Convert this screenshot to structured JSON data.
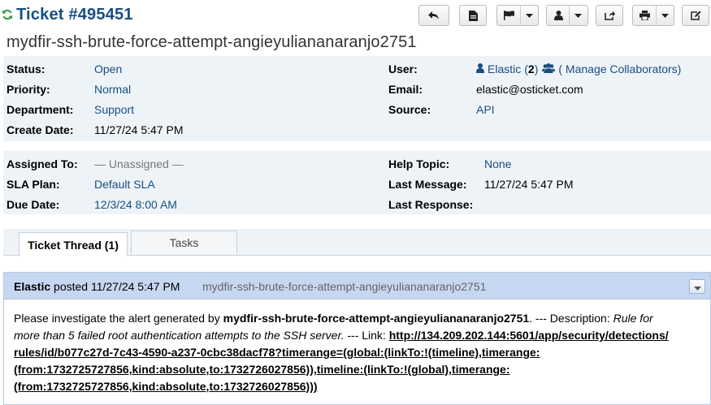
{
  "header": {
    "ticket_number": "Ticket #495451",
    "subject": "mydfir-ssh-brute-force-attempt-angieyuliananaranjo2751"
  },
  "toolbar": {
    "buttons": [
      "reply",
      "edit-document",
      "flag",
      "assign-user",
      "transfer",
      "print",
      "edit"
    ]
  },
  "info1": {
    "status_label": "Status:",
    "status_value": "Open",
    "priority_label": "Priority:",
    "priority_value": "Normal",
    "department_label": "Department:",
    "department_value": "Support",
    "create_date_label": "Create Date:",
    "create_date_value": "11/27/24 5:47 PM",
    "user_label": "User:",
    "user_name": "Elastic",
    "user_count_open": "(",
    "user_count": "2",
    "user_count_close": ")",
    "manage_collaborators": "( Manage Collaborators)",
    "email_label": "Email:",
    "email_value": "elastic@osticket.com",
    "source_label": "Source:",
    "source_value": "API"
  },
  "info2": {
    "assigned_label": "Assigned To:",
    "assigned_value": "— Unassigned —",
    "sla_label": "SLA Plan:",
    "sla_value": "Default SLA",
    "due_label": "Due Date:",
    "due_value": "12/3/24 8:00 AM",
    "help_topic_label": "Help Topic:",
    "help_topic_value": "None",
    "last_message_label": "Last Message:",
    "last_message_value": "11/27/24 5:47 PM",
    "last_response_label": "Last Response:",
    "last_response_value": ""
  },
  "tabs": {
    "thread": "Ticket Thread (1)",
    "tasks": "Tasks"
  },
  "entry": {
    "poster_name": "Elastic",
    "posted_text": "posted 11/27/24 5:47 PM",
    "title": "mydfir-ssh-brute-force-attempt-angieyuliananaranjo2751",
    "body_intro": "Please investigate the alert generated by ",
    "body_alert": "mydfir-ssh-brute-force-attempt-angieyuliananaranjo2751",
    "body_desc_prefix": ". --- Description: ",
    "body_desc_1": "Rule for",
    "body_desc_2": "more than 5 failed root authentication attempts to the SSH server.",
    "body_link_prefix": " --- Link: ",
    "link_line_1": "http://134.209.202.144:5601/app/security/detections/",
    "link_line_2": "rules/id/b077c27d-7c43-4590-a237-0cbc38dacf78?timerange=(global:(linkTo:!(timeline),timerange:",
    "link_line_3": "(from:1732725727856,kind:absolute,to:1732726027856)),timeline:(linkTo:!(global),timerange:",
    "link_line_4": "(from:1732725727856,kind:absolute,to:1732726027856)))"
  },
  "colors": {
    "title_blue": "#184e81",
    "info_bg": "#eef3f8",
    "thread_header_bg": "#c6d7f2",
    "refresh_green": "#2e9e3a"
  }
}
